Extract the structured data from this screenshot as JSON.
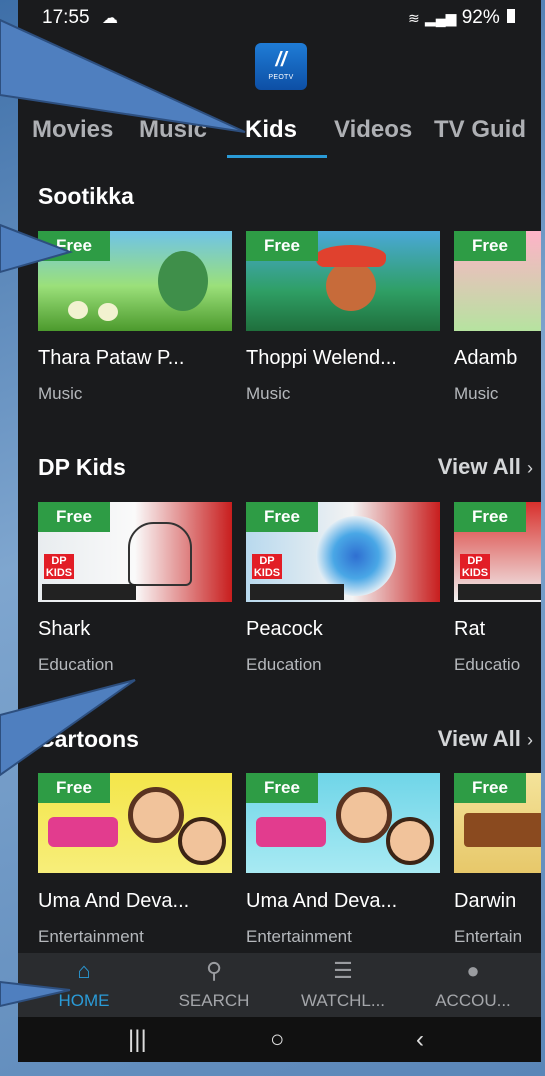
{
  "status": {
    "time": "17:55",
    "battery": "92%"
  },
  "app": {
    "logo_text": "PEOTV"
  },
  "tabs": [
    {
      "label": "Movies",
      "active": false
    },
    {
      "label": "Music",
      "active": false
    },
    {
      "label": "Kids",
      "active": true
    },
    {
      "label": "Videos",
      "active": false
    },
    {
      "label": "TV Guid",
      "active": false
    }
  ],
  "sections": [
    {
      "title": "Sootikka",
      "view_all": "",
      "items": [
        {
          "badge": "Free",
          "title": "Thara Pataw P...",
          "category": "Music"
        },
        {
          "badge": "Free",
          "title": "Thoppi Welend...",
          "category": "Music"
        },
        {
          "badge": "Free",
          "title": "Adamb",
          "category": "Music"
        }
      ]
    },
    {
      "title": "DP Kids",
      "view_all": "View All",
      "items": [
        {
          "badge": "Free",
          "title": "Shark",
          "category": "Education",
          "logo": "DP KIDS"
        },
        {
          "badge": "Free",
          "title": "Peacock",
          "category": "Education",
          "logo": "DP KIDS"
        },
        {
          "badge": "Free",
          "title": "Rat",
          "category": "Educatio",
          "logo": "DP KIDS"
        }
      ]
    },
    {
      "title": "Cartoons",
      "view_all": "View All",
      "items": [
        {
          "badge": "Free",
          "title": "Uma And Deva...",
          "category": "Entertainment"
        },
        {
          "badge": "Free",
          "title": "Uma And Deva...",
          "category": "Entertainment"
        },
        {
          "badge": "Free",
          "title": "Darwin",
          "category": "Entertain"
        }
      ]
    }
  ],
  "bottom_nav": [
    {
      "label": "HOME",
      "icon": "home-icon",
      "active": true
    },
    {
      "label": "SEARCH",
      "icon": "search-icon",
      "active": false
    },
    {
      "label": "WATCHL...",
      "icon": "watchlist-icon",
      "active": false
    },
    {
      "label": "ACCOU...",
      "icon": "account-icon",
      "active": false
    }
  ],
  "colors": {
    "accent": "#2a9bd7",
    "badge": "#2e9c45",
    "background": "#1a1b1d",
    "pointer": "#4f7fbf"
  }
}
